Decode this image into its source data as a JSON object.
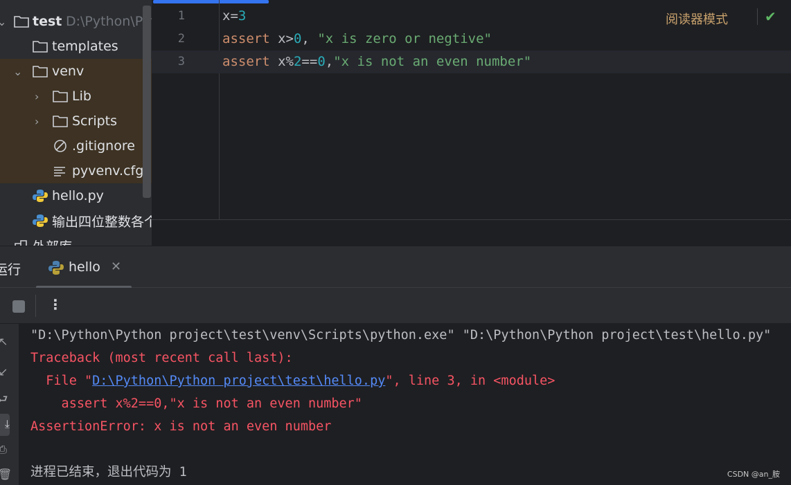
{
  "tree": {
    "root": {
      "name": "test",
      "path": "D:\\Python\\Python project\\test"
    },
    "items": [
      {
        "label": "templates",
        "type": "folder"
      },
      {
        "label": "venv",
        "type": "folder",
        "expanded": true
      },
      {
        "label": "Lib",
        "type": "folder"
      },
      {
        "label": "Scripts",
        "type": "folder"
      },
      {
        "label": ".gitignore",
        "type": "ignore-file"
      },
      {
        "label": "pyvenv.cfg",
        "type": "text-file"
      },
      {
        "label": "hello.py",
        "type": "python-file"
      },
      {
        "label": "输出四位整数各个",
        "type": "python-file"
      },
      {
        "label": "外部库",
        "type": "library"
      }
    ]
  },
  "editor": {
    "reader_mode": "阅读器模式",
    "lines": [
      {
        "n": "1",
        "parts": [
          [
            "plain",
            "x="
          ],
          [
            "num",
            "3"
          ]
        ]
      },
      {
        "n": "2",
        "parts": [
          [
            "kw",
            "assert "
          ],
          [
            "plain",
            "x>"
          ],
          [
            "num",
            "0"
          ],
          [
            "plain",
            ", "
          ],
          [
            "str",
            "\"x is zero or negtive\""
          ]
        ]
      },
      {
        "n": "3",
        "parts": [
          [
            "kw",
            "assert "
          ],
          [
            "plain",
            "x%"
          ],
          [
            "num",
            "2"
          ],
          [
            "plain",
            "=="
          ],
          [
            "num",
            "0"
          ],
          [
            "plain",
            ","
          ],
          [
            "str",
            "\"x is not an even number\""
          ]
        ]
      }
    ]
  },
  "run": {
    "panel_title": "运行",
    "tab": "hello",
    "console": [
      [
        [
          "plain",
          "\"D:\\Python\\Python project\\test\\venv\\Scripts\\python.exe\" \"D:\\Python\\Python project\\test\\hello.py\""
        ]
      ],
      [
        [
          "red",
          "Traceback (most recent call last):"
        ]
      ],
      [
        [
          "red",
          "  File \""
        ],
        [
          "link",
          "D:\\Python\\Python project\\test\\hello.py"
        ],
        [
          "red",
          "\", line 3, in <module>"
        ]
      ],
      [
        [
          "red",
          "    assert x%2==0,\"x is not an even number\""
        ]
      ],
      [
        [
          "red",
          "AssertionError: x is not an even number"
        ]
      ],
      [
        [
          "plain",
          ""
        ]
      ],
      [
        [
          "plain",
          "进程已结束，退出代码为 1"
        ]
      ]
    ]
  },
  "watermark": "CSDN @an_胺",
  "colors": {
    "keyword": "#cf8e6d",
    "number": "#2aacb8",
    "string": "#6aab73",
    "error": "#f75464",
    "link": "#548af7",
    "accent": "#3574f0"
  }
}
